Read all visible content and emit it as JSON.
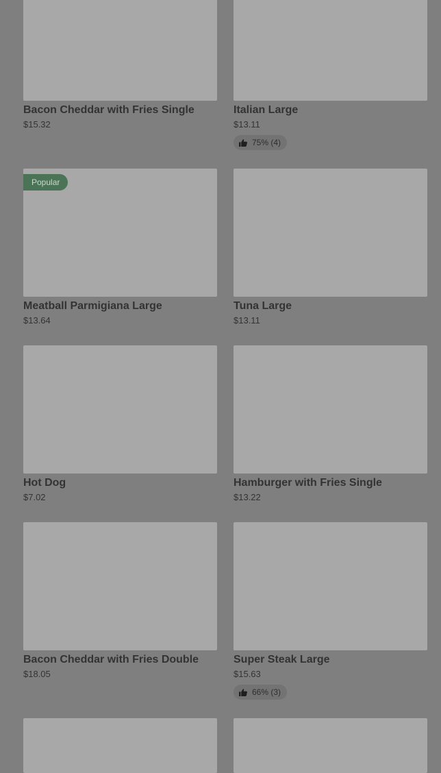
{
  "items": [
    {
      "name": "Bacon Cheddar with Fries Single",
      "price": "$15.32"
    },
    {
      "name": "Italian Large",
      "price": "$13.11",
      "rating": "75% (4)"
    },
    {
      "name": "Meatball Parmigiana Large",
      "price": "$13.64",
      "badge": "Popular"
    },
    {
      "name": "Tuna Large",
      "price": "$13.11"
    },
    {
      "name": "Hot Dog",
      "price": "$7.02"
    },
    {
      "name": "Hamburger with Fries Single",
      "price": "$13.22"
    },
    {
      "name": "Bacon Cheddar with Fries Double",
      "price": "$18.05"
    },
    {
      "name": "Super Steak Large",
      "price": "$15.63",
      "rating": "66% (3)"
    }
  ],
  "icons": {
    "rating": "thumbs-up-icon"
  }
}
